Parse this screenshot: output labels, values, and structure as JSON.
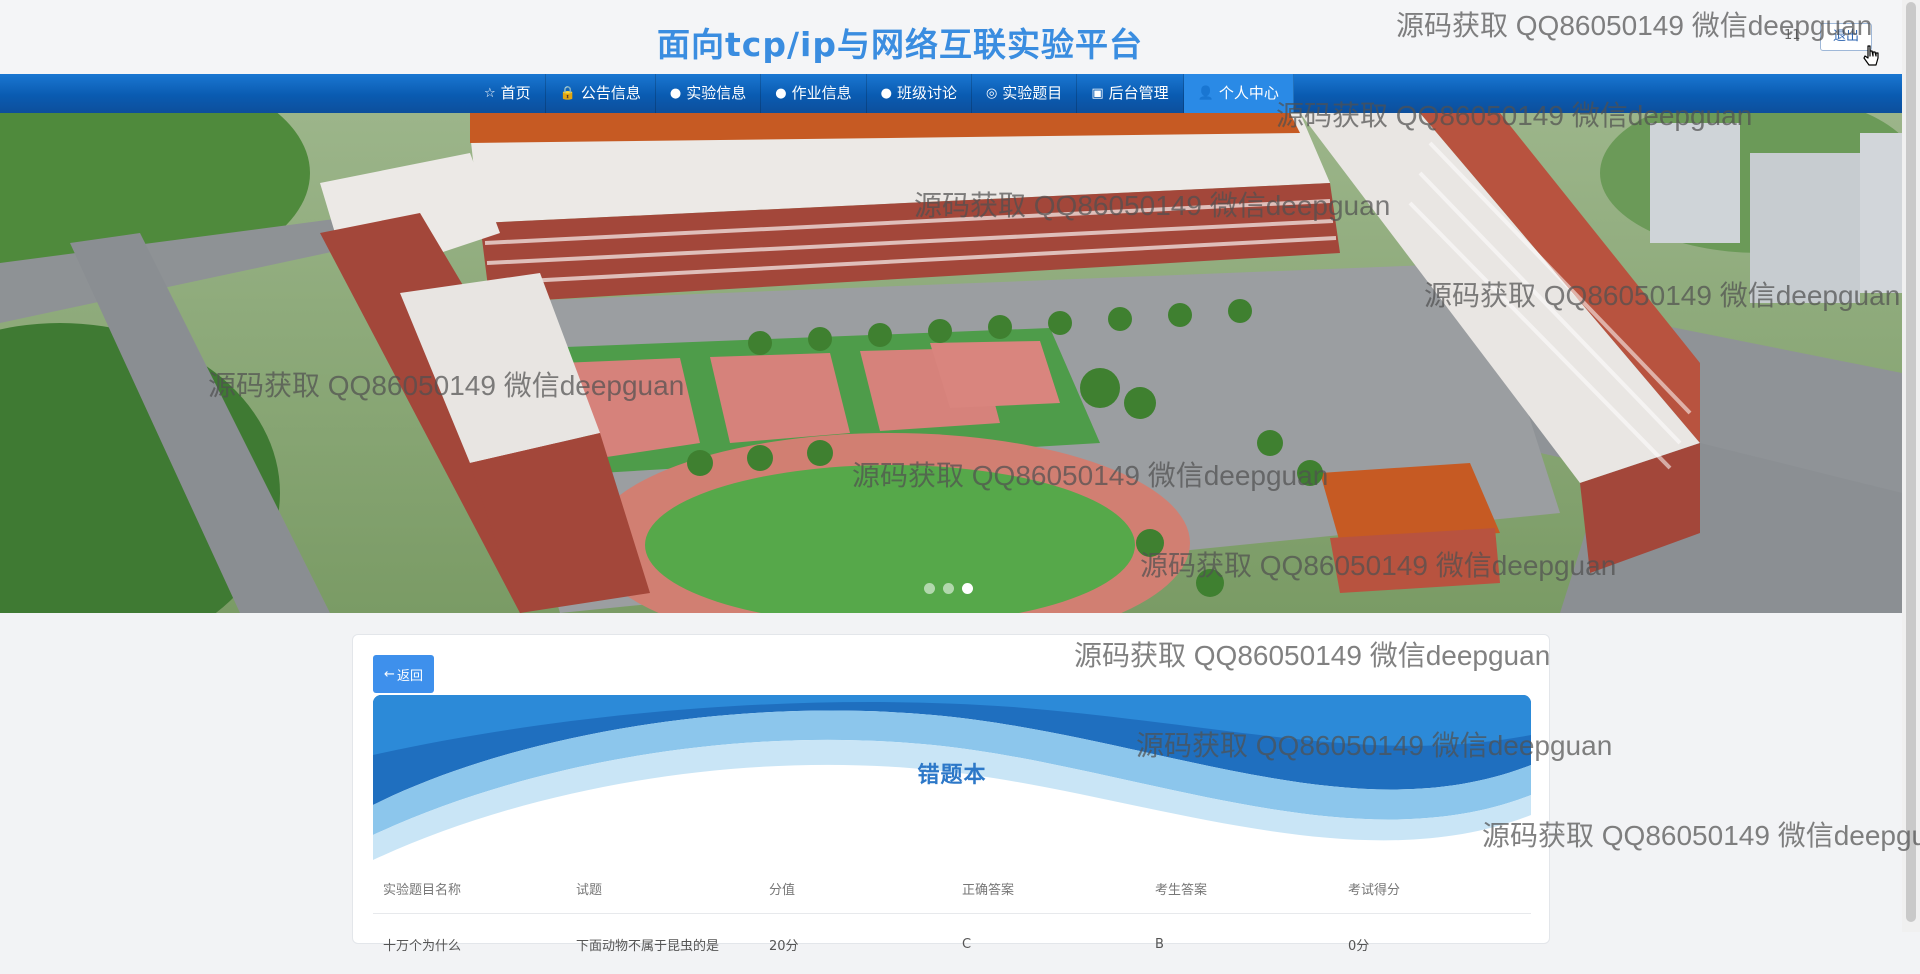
{
  "header": {
    "site_title": "面向tcp/ip与网络互联实验平台",
    "user_name": "11",
    "logout_label": "退出"
  },
  "nav": {
    "items": [
      {
        "label": "首页",
        "icon": "☆",
        "icon_name": "star-icon"
      },
      {
        "label": "公告信息",
        "icon": "🔒",
        "icon_name": "lock-icon"
      },
      {
        "label": "实验信息",
        "icon": "●",
        "icon_name": "info-icon"
      },
      {
        "label": "作业信息",
        "icon": "●",
        "icon_name": "question-icon"
      },
      {
        "label": "班级讨论",
        "icon": "●",
        "icon_name": "info-icon"
      },
      {
        "label": "实验题目",
        "icon": "◎",
        "icon_name": "target-icon"
      },
      {
        "label": "后台管理",
        "icon": "▣",
        "icon_name": "briefcase-icon"
      },
      {
        "label": "个人中心",
        "icon": "👤",
        "icon_name": "user-icon"
      }
    ],
    "active_index": 7
  },
  "banner": {
    "slides": 3,
    "active_slide": 3
  },
  "content": {
    "back_label": "返回",
    "back_icon": "←",
    "title": "错题本",
    "table": {
      "headers": [
        "实验题目名称",
        "试题",
        "分值",
        "正确答案",
        "考生答案",
        "考试得分"
      ],
      "rows": [
        [
          "十万个为什么",
          "下面动物不属于昆虫的是",
          "20分",
          "C",
          "B",
          "0分"
        ]
      ]
    }
  },
  "watermark_text": "源码获取 QQ86050149 微信deepguan",
  "colors": {
    "title_blue": "#3a8de0",
    "nav_blue": "#0a5bb1",
    "button_blue": "#3e90ec"
  }
}
